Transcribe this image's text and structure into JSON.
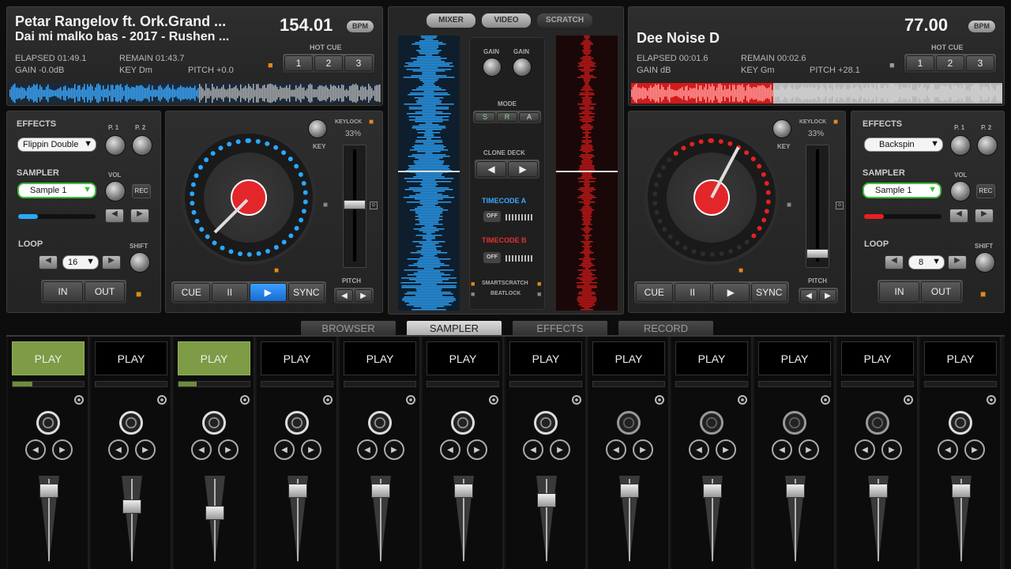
{
  "deck_a": {
    "title": "Petar Rangelov ft. Ork.Grand ...",
    "subtitle": "Dai mi malko bas - 2017 - Rushen ...",
    "bpm": "154.01",
    "bpm_badge": "BPM",
    "elapsed": "ELAPSED 01:49.1",
    "remain": "REMAIN 01:43.7",
    "gain": "GAIN -0.0dB",
    "key": "KEY Dm",
    "pitch": "PITCH +0.0",
    "hot_cue_label": "HOT CUE",
    "hot_cues": [
      "1",
      "2",
      "3"
    ],
    "effects_label": "EFFECTS",
    "effect_selected": "Flippin Double",
    "p1": "P. 1",
    "p2": "P. 2",
    "sampler_label": "SAMPLER",
    "sample_selected": "Sample 1",
    "vol_label": "VOL",
    "rec_label": "REC",
    "loop_label": "LOOP",
    "loop_value": "16",
    "shift_label": "SHIFT",
    "in_label": "IN",
    "out_label": "OUT",
    "key_label": "KEY",
    "keylock_label": "KEYLOCK",
    "keylock_pct": "33%",
    "pitch_label": "PITCH",
    "cue": "CUE",
    "pause": "II",
    "play": "▶",
    "sync": "SYNC"
  },
  "deck_b": {
    "title": "Dee Noise D",
    "bpm": "77.00",
    "bpm_badge": "BPM",
    "elapsed": "ELAPSED 00:01.6",
    "remain": "REMAIN 00:02.6",
    "gain": "GAIN dB",
    "key": "KEY Gm",
    "pitch": "PITCH +28.1",
    "hot_cue_label": "HOT CUE",
    "hot_cues": [
      "1",
      "2",
      "3"
    ],
    "effects_label": "EFFECTS",
    "effect_selected": "Backspin",
    "p1": "P. 1",
    "p2": "P. 2",
    "sampler_label": "SAMPLER",
    "sample_selected": "Sample 1",
    "vol_label": "VOL",
    "rec_label": "REC",
    "loop_label": "LOOP",
    "loop_value": "8",
    "shift_label": "SHIFT",
    "in_label": "IN",
    "out_label": "OUT",
    "key_label": "KEY",
    "keylock_label": "KEYLOCK",
    "keylock_pct": "33%",
    "pitch_label": "PITCH",
    "cue": "CUE",
    "pause": "II",
    "play": "▶",
    "sync": "SYNC"
  },
  "center": {
    "tabs": [
      "MIXER",
      "VIDEO",
      "SCRATCH"
    ],
    "gain": "GAIN",
    "mode_label": "MODE",
    "modes": [
      "S",
      "R",
      "A"
    ],
    "clone_deck": "CLONE DECK",
    "timecode_a": "TIMECODE A",
    "timecode_b": "TIMECODE B",
    "off": "OFF",
    "smartscratch": "SMARTSCRATCH",
    "beatlock": "BEATLOCK"
  },
  "bottom_tabs": [
    "BROWSER",
    "SAMPLER",
    "EFFECTS",
    "RECORD"
  ],
  "sampler_slots": [
    {
      "label": "PLAY",
      "active": true,
      "progress": 0.28,
      "knob": true,
      "fader": 0.1
    },
    {
      "label": "PLAY",
      "active": false,
      "progress": 0,
      "knob": true,
      "fader": 0.3
    },
    {
      "label": "PLAY",
      "active": true,
      "progress": 0.25,
      "knob": true,
      "fader": 0.38
    },
    {
      "label": "PLAY",
      "active": false,
      "progress": 0,
      "knob": true,
      "fader": 0.1
    },
    {
      "label": "PLAY",
      "active": false,
      "progress": 0,
      "knob": true,
      "fader": 0.1
    },
    {
      "label": "PLAY",
      "active": false,
      "progress": 0,
      "knob": true,
      "fader": 0.1
    },
    {
      "label": "PLAY",
      "active": false,
      "progress": 0,
      "knob": true,
      "fader": 0.22
    },
    {
      "label": "PLAY",
      "active": false,
      "progress": 0,
      "knob": false,
      "fader": 0.1
    },
    {
      "label": "PLAY",
      "active": false,
      "progress": 0,
      "knob": false,
      "fader": 0.1
    },
    {
      "label": "PLAY",
      "active": false,
      "progress": 0,
      "knob": false,
      "fader": 0.1
    },
    {
      "label": "PLAY",
      "active": false,
      "progress": 0,
      "knob": false,
      "fader": 0.1
    },
    {
      "label": "PLAY",
      "active": false,
      "progress": 0,
      "knob": true,
      "fader": 0.1
    }
  ],
  "colors": {
    "deck_a_accent": "#2aa8ff",
    "deck_b_accent": "#e82020",
    "active_pad": "#7d9c45"
  }
}
